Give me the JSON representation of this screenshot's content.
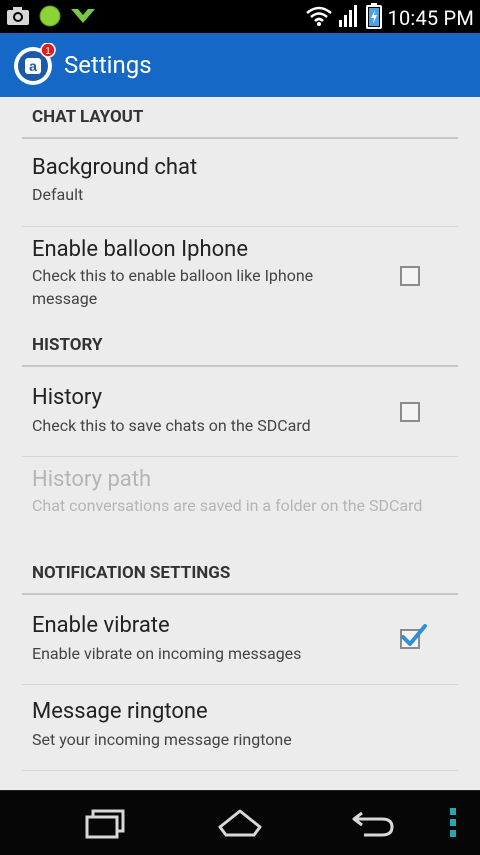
{
  "status_bar": {
    "time": "10:45 PM",
    "icons": [
      "camera-icon",
      "green-circle-icon",
      "download-icon",
      "wifi-icon",
      "signal-icon",
      "battery-charging-icon"
    ]
  },
  "app_bar": {
    "title": "Settings",
    "badge": "1",
    "logo_letter": "a",
    "color": "#1568c6"
  },
  "sections": {
    "chat_layout": {
      "header": "CHAT LAYOUT",
      "background_chat": {
        "title": "Background chat",
        "summary": "Default"
      },
      "balloon": {
        "title": "Enable balloon Iphone",
        "summary": "Check this to enable balloon like Iphone message",
        "checked": false
      }
    },
    "history": {
      "header": "HISTORY",
      "history": {
        "title": "History",
        "summary": "Check this to save chats on the SDCard",
        "checked": false
      },
      "history_path": {
        "title": "History path",
        "summary": "Chat conversations are saved in a folder on the SDCard",
        "enabled": false
      }
    },
    "notification": {
      "header": "NOTIFICATION SETTINGS",
      "vibrate": {
        "title": "Enable vibrate",
        "summary": "Enable vibrate on incoming messages",
        "checked": true
      },
      "ringtone": {
        "title": "Message ringtone",
        "summary": "Set your incoming message ringtone"
      }
    }
  },
  "nav_bar": {
    "buttons": [
      "recent-apps-icon",
      "home-icon",
      "back-icon",
      "overflow-menu-icon"
    ]
  },
  "colors": {
    "checkbox_tick": "#2f8fd8",
    "overflow_dots": "#28a7b0"
  }
}
